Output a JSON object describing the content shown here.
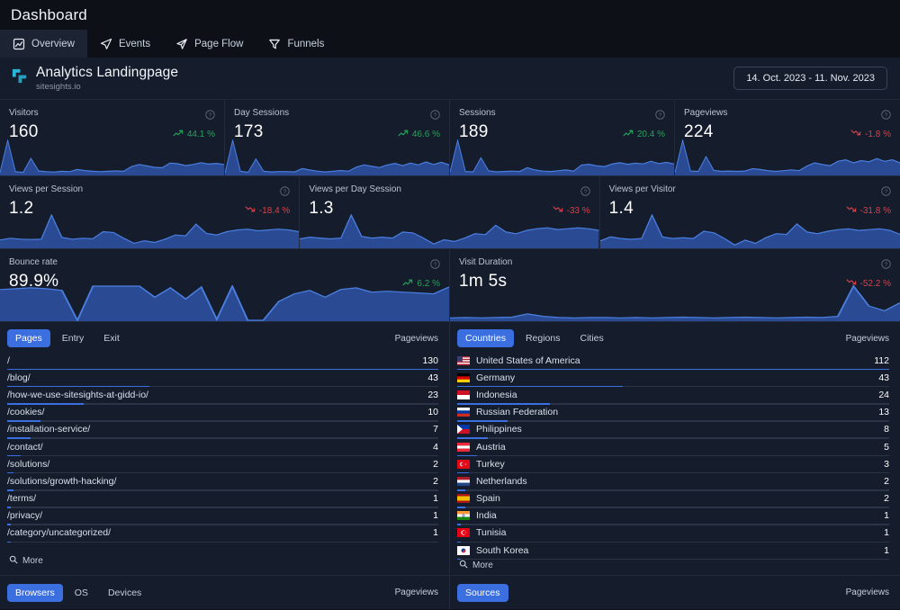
{
  "topbar": {
    "title": "Dashboard"
  },
  "nav": {
    "tabs": [
      {
        "label": "Overview",
        "icon": "line-chart-icon",
        "active": true
      },
      {
        "label": "Events",
        "icon": "paper-plane-icon",
        "active": false
      },
      {
        "label": "Page Flow",
        "icon": "flow-arrow-icon",
        "active": false
      },
      {
        "label": "Funnels",
        "icon": "funnel-icon",
        "active": false
      }
    ]
  },
  "site": {
    "name": "Analytics Landingpage",
    "url": "sitesights.io",
    "logo_color": "#29b6d8",
    "date_range": "14. Oct. 2023 - 11. Nov. 2023"
  },
  "colors": {
    "accent": "#3b6fe0",
    "up": "#27a35a",
    "down": "#d5424a",
    "card_bg": "#151c2c",
    "page_bg": "#0d1117"
  },
  "metrics": {
    "row1": [
      {
        "title": "Visitors",
        "value": "160",
        "delta": "44.1 %",
        "dir": "up"
      },
      {
        "title": "Day Sessions",
        "value": "173",
        "delta": "46.6 %",
        "dir": "up"
      },
      {
        "title": "Sessions",
        "value": "189",
        "delta": "20.4 %",
        "dir": "up"
      },
      {
        "title": "Pageviews",
        "value": "224",
        "delta": "-1.8 %",
        "dir": "down"
      }
    ],
    "row2": [
      {
        "title": "Views per Session",
        "value": "1.2",
        "delta": "-18.4 %",
        "dir": "down"
      },
      {
        "title": "Views per Day Session",
        "value": "1.3",
        "delta": "-33 %",
        "dir": "down"
      },
      {
        "title": "Views per Visitor",
        "value": "1.4",
        "delta": "-31.8 %",
        "dir": "down"
      }
    ],
    "row3": [
      {
        "title": "Bounce rate",
        "value": "89.9%",
        "delta": "6.2 %",
        "dir": "up"
      },
      {
        "title": "Visit Duration",
        "value": "1m 5s",
        "delta": "-52.2 %",
        "dir": "down"
      }
    ]
  },
  "chart_data": [
    {
      "type": "area",
      "title": "Visitors",
      "ylim": [
        0,
        100
      ],
      "values": [
        5,
        95,
        8,
        6,
        45,
        10,
        8,
        7,
        9,
        8,
        14,
        11,
        9,
        8,
        9,
        10,
        9,
        22,
        28,
        24,
        20,
        19,
        32,
        30,
        25,
        28,
        33,
        29,
        31,
        28
      ]
    },
    {
      "type": "area",
      "title": "Day Sessions",
      "ylim": [
        0,
        100
      ],
      "values": [
        4,
        92,
        9,
        6,
        42,
        9,
        7,
        8,
        8,
        7,
        16,
        12,
        9,
        7,
        9,
        11,
        9,
        20,
        26,
        22,
        19,
        26,
        30,
        24,
        31,
        26,
        34,
        27,
        33,
        26
      ]
    },
    {
      "type": "area",
      "title": "Sessions",
      "ylim": [
        0,
        100
      ],
      "values": [
        6,
        90,
        8,
        7,
        44,
        10,
        7,
        8,
        9,
        8,
        18,
        12,
        9,
        8,
        10,
        12,
        9,
        25,
        27,
        23,
        21,
        28,
        31,
        27,
        30,
        28,
        35,
        29,
        32,
        28
      ]
    },
    {
      "type": "area",
      "title": "Pageviews",
      "ylim": [
        0,
        100
      ],
      "values": [
        5,
        88,
        9,
        8,
        46,
        11,
        8,
        9,
        8,
        9,
        15,
        13,
        10,
        8,
        10,
        12,
        10,
        22,
        30,
        26,
        23,
        34,
        38,
        30,
        36,
        33,
        41,
        34,
        38,
        30
      ]
    },
    {
      "type": "area",
      "title": "Views per Session",
      "ylim": [
        0,
        100
      ],
      "values": [
        18,
        22,
        20,
        19,
        20,
        78,
        24,
        20,
        22,
        21,
        38,
        36,
        22,
        10,
        16,
        12,
        20,
        30,
        28,
        56,
        34,
        30,
        38,
        42,
        44,
        40,
        42,
        44,
        42,
        38
      ]
    },
    {
      "type": "area",
      "title": "Views per Day Session",
      "ylim": [
        0,
        100
      ],
      "values": [
        20,
        24,
        22,
        20,
        22,
        76,
        26,
        22,
        24,
        22,
        36,
        34,
        22,
        8,
        18,
        14,
        22,
        32,
        30,
        52,
        36,
        32,
        40,
        44,
        46,
        42,
        44,
        46,
        44,
        40
      ]
    },
    {
      "type": "area",
      "title": "Views per Visitor",
      "ylim": [
        0,
        100
      ],
      "values": [
        16,
        26,
        22,
        20,
        22,
        80,
        26,
        22,
        24,
        22,
        40,
        36,
        22,
        6,
        18,
        10,
        24,
        34,
        32,
        58,
        38,
        34,
        40,
        44,
        46,
        42,
        44,
        46,
        42,
        32
      ]
    },
    {
      "type": "area",
      "title": "Bounce rate",
      "ylim": [
        0,
        100
      ],
      "values": [
        72,
        74,
        76,
        74,
        70,
        0,
        80,
        80,
        80,
        80,
        54,
        76,
        50,
        78,
        2,
        80,
        0,
        0,
        44,
        62,
        70,
        54,
        72,
        76,
        66,
        68,
        66,
        64,
        62,
        78
      ]
    },
    {
      "type": "area",
      "title": "Visit Duration",
      "ylim": [
        0,
        100
      ],
      "values": [
        6,
        7,
        6,
        7,
        8,
        16,
        10,
        7,
        6,
        7,
        7,
        6,
        7,
        6,
        7,
        8,
        7,
        6,
        7,
        8,
        7,
        6,
        7,
        8,
        7,
        10,
        86,
        36,
        24,
        44
      ]
    }
  ],
  "pages_panel": {
    "tabs": [
      {
        "label": "Pages",
        "active": true
      },
      {
        "label": "Entry",
        "active": false
      },
      {
        "label": "Exit",
        "active": false
      }
    ],
    "column_label": "Pageviews",
    "more_label": "More",
    "rows": [
      {
        "name": "/",
        "value": "130",
        "pct": 100
      },
      {
        "name": "/blog/",
        "value": "43",
        "pct": 33
      },
      {
        "name": "/how-we-use-sitesights-at-gidd-io/",
        "value": "23",
        "pct": 17.7
      },
      {
        "name": "/cookies/",
        "value": "10",
        "pct": 7.7
      },
      {
        "name": "/installation-service/",
        "value": "7",
        "pct": 5.4
      },
      {
        "name": "/contact/",
        "value": "4",
        "pct": 3.1
      },
      {
        "name": "/solutions/",
        "value": "2",
        "pct": 1.5
      },
      {
        "name": "/solutions/growth-hacking/",
        "value": "2",
        "pct": 1.5
      },
      {
        "name": "/terms/",
        "value": "1",
        "pct": 0.8
      },
      {
        "name": "/privacy/",
        "value": "1",
        "pct": 0.8
      },
      {
        "name": "/category/uncategorized/",
        "value": "1",
        "pct": 0.8
      }
    ]
  },
  "countries_panel": {
    "tabs": [
      {
        "label": "Countries",
        "active": true
      },
      {
        "label": "Regions",
        "active": false
      },
      {
        "label": "Cities",
        "active": false
      }
    ],
    "column_label": "Pageviews",
    "more_label": "More",
    "rows": [
      {
        "name": "United States of America",
        "value": "112",
        "pct": 100,
        "flag": "us"
      },
      {
        "name": "Germany",
        "value": "43",
        "pct": 38.4,
        "flag": "de"
      },
      {
        "name": "Indonesia",
        "value": "24",
        "pct": 21.4,
        "flag": "id"
      },
      {
        "name": "Russian Federation",
        "value": "13",
        "pct": 11.6,
        "flag": "ru"
      },
      {
        "name": "Philippines",
        "value": "8",
        "pct": 7.1,
        "flag": "ph"
      },
      {
        "name": "Austria",
        "value": "5",
        "pct": 4.5,
        "flag": "at"
      },
      {
        "name": "Turkey",
        "value": "3",
        "pct": 2.7,
        "flag": "tr"
      },
      {
        "name": "Netherlands",
        "value": "2",
        "pct": 1.8,
        "flag": "nl"
      },
      {
        "name": "Spain",
        "value": "2",
        "pct": 1.8,
        "flag": "es"
      },
      {
        "name": "India",
        "value": "1",
        "pct": 0.9,
        "flag": "in"
      },
      {
        "name": "Tunisia",
        "value": "1",
        "pct": 0.9,
        "flag": "tn"
      },
      {
        "name": "South Korea",
        "value": "1",
        "pct": 0.9,
        "flag": "kr"
      }
    ]
  },
  "bottom": {
    "left": {
      "tabs": [
        {
          "label": "Browsers",
          "active": true
        },
        {
          "label": "OS",
          "active": false
        },
        {
          "label": "Devices",
          "active": false
        }
      ],
      "column_label": "Pageviews"
    },
    "right": {
      "tabs": [
        {
          "label": "Sources",
          "active": true
        }
      ],
      "column_label": "Pageviews"
    }
  }
}
